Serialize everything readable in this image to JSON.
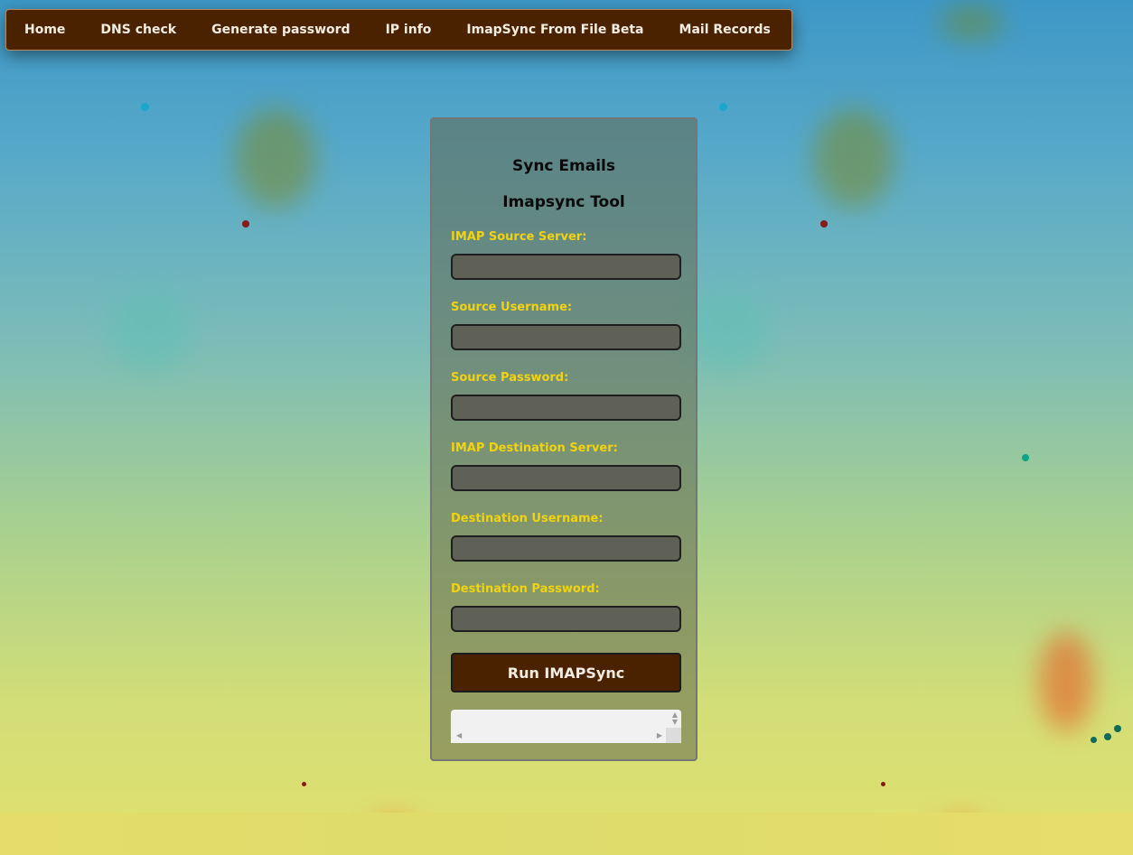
{
  "nav": {
    "items": [
      {
        "label": "Home"
      },
      {
        "label": "DNS check"
      },
      {
        "label": "Generate password"
      },
      {
        "label": "IP info"
      },
      {
        "label": "ImapSync From File Beta"
      },
      {
        "label": "Mail Records"
      }
    ]
  },
  "form": {
    "title": "Sync Emails",
    "subtitle": "Imapsync Tool",
    "fields": [
      {
        "label": "IMAP Source Server:",
        "value": "",
        "placeholder": ""
      },
      {
        "label": "Source Username:",
        "value": "",
        "placeholder": ""
      },
      {
        "label": "Source Password:",
        "value": "",
        "placeholder": ""
      },
      {
        "label": "IMAP Destination Server:",
        "value": "",
        "placeholder": ""
      },
      {
        "label": "Destination Username:",
        "value": "",
        "placeholder": ""
      },
      {
        "label": "Destination Password:",
        "value": "",
        "placeholder": ""
      }
    ],
    "submit_label": "Run IMAPSync",
    "output_text": ""
  },
  "colors": {
    "nav_bg": "#4a2200",
    "label_color": "#f1d310",
    "button_bg": "#4a2200"
  }
}
